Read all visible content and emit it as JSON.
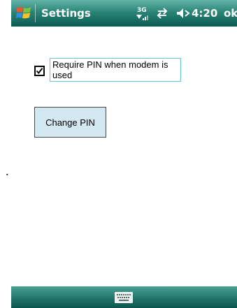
{
  "titlebar": {
    "title": "Settings",
    "clock": "4:20",
    "ok_label": "ok",
    "icons": {
      "start": "windows-start-icon",
      "signal": "3g-signal-icon",
      "sync": "sync-arrows-icon",
      "volume": "volume-icon"
    }
  },
  "content": {
    "require_pin": {
      "label": "Require PIN when modem is used",
      "checked": true
    },
    "change_pin_button": "Change PIN"
  },
  "bottombar": {
    "icon": "keyboard-icon"
  },
  "colors": {
    "titlebar": "#2a8577",
    "button_bg": "#d4e8f2",
    "focus_border": "#63c7d9"
  }
}
